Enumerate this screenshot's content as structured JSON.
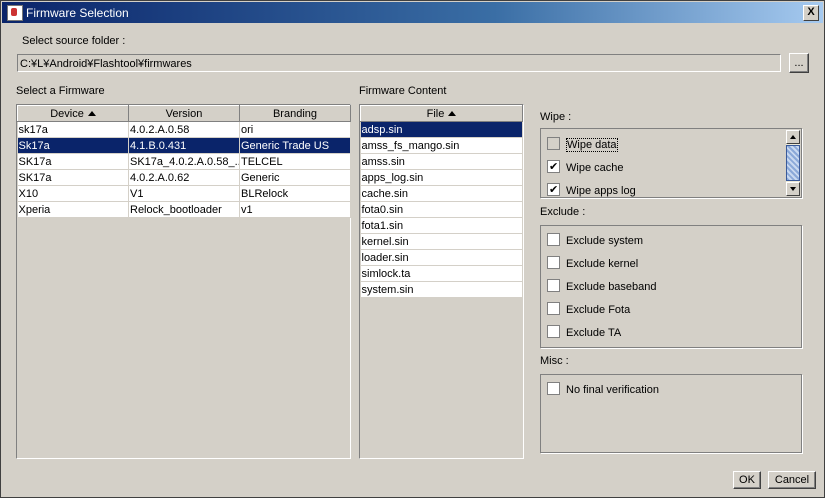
{
  "window": {
    "title": "Firmware Selection",
    "close_glyph": "X"
  },
  "source": {
    "label": "Select source folder :",
    "path": "C:¥L¥Android¥Flashtool¥firmwares",
    "browse_label": "..."
  },
  "firmware": {
    "label": "Select a Firmware",
    "columns": [
      "Device",
      "Version",
      "Branding"
    ],
    "rows": [
      [
        "sk17a",
        "4.0.2.A.0.58",
        "ori"
      ],
      [
        "Sk17a",
        "4.1.B.0.431",
        "Generic Trade US"
      ],
      [
        "SK17a",
        "SK17a_4.0.2.A.0.58_...",
        "TELCEL"
      ],
      [
        "SK17a",
        "4.0.2.A.0.62",
        "Generic"
      ],
      [
        "X10",
        "V1",
        "BLRelock"
      ],
      [
        "Xperia",
        "Relock_bootloader",
        "v1"
      ]
    ]
  },
  "content": {
    "label": "Firmware Content",
    "column": "File",
    "files": [
      "adsp.sin",
      "amss_fs_mango.sin",
      "amss.sin",
      "apps_log.sin",
      "cache.sin",
      "fota0.sin",
      "fota1.sin",
      "kernel.sin",
      "loader.sin",
      "simlock.ta",
      "system.sin"
    ]
  },
  "wipe": {
    "label": "Wipe :",
    "items": [
      "Wipe data",
      "Wipe cache",
      "Wipe apps log"
    ]
  },
  "exclude": {
    "label": "Exclude :",
    "items": [
      "Exclude system",
      "Exclude kernel",
      "Exclude baseband",
      "Exclude Fota",
      "Exclude TA"
    ]
  },
  "misc": {
    "label": "Misc :",
    "items": [
      "No final verification"
    ]
  },
  "buttons": {
    "ok": "OK",
    "cancel": "Cancel"
  },
  "colors": {
    "selection": "#0a246a",
    "titlebar": "#0a246a",
    "face": "#d4d0c8"
  }
}
